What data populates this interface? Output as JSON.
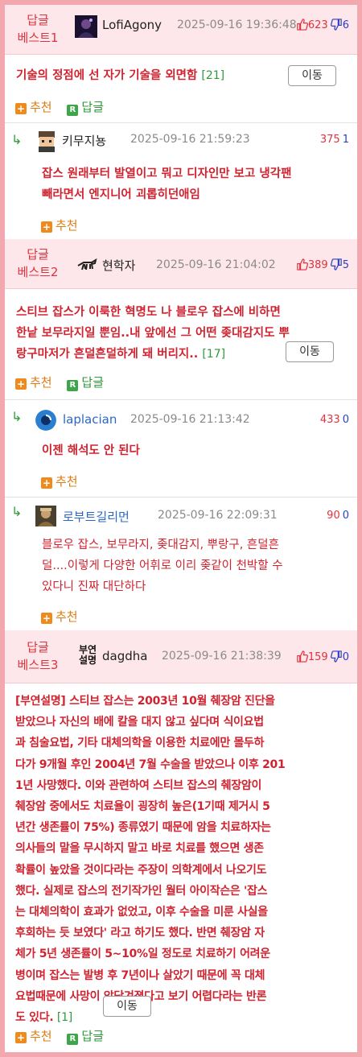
{
  "best1": {
    "rank": [
      "답글",
      "베스트1"
    ],
    "user": "LofiAgony",
    "date": "2025-09-16 19:36:48",
    "up": "623",
    "down": "6",
    "title": "기술의 정점에 선 자가 기술을 외면함",
    "comment_count": "[21]",
    "move_label": "이동",
    "recommend_label": "추천",
    "reply_label": "답글"
  },
  "reply1": {
    "user": "키무지뇽",
    "date": "2025-09-16 21:59:23",
    "up": "375",
    "down": "1",
    "lines": [
      "잡스 원래부터 발열이고 뭐고 디자인만 보고 냉각팬",
      "빼라면서 엔지니어 괴롭히던애임"
    ],
    "recommend_label": "추천"
  },
  "best2": {
    "rank": [
      "답글",
      "베스트2"
    ],
    "user": "현학자",
    "date": "2025-09-16 21:04:02",
    "up": "389",
    "down": "5",
    "lines": [
      "스티브 잡스가 이룩한 혁명도 나 블로우 잡스에 비하면",
      "한낱 보무라지일 뿐임..내 앞에선 그 어떤 좆대감지도 뿌",
      "랑구마저가 흔덜흔덜하게 돼 버리지.."
    ],
    "comment_count": "[17]",
    "move_label": "이동",
    "recommend_label": "추천",
    "reply_label": "답글"
  },
  "reply2": {
    "user": "laplacian",
    "date": "2025-09-16 21:13:42",
    "up": "433",
    "down": "0",
    "lines": [
      "이젠 해석도 안 된다"
    ],
    "recommend_label": "추천"
  },
  "reply3": {
    "user": "로부트길리먼",
    "date": "2025-09-16 22:09:31",
    "up": "90",
    "down": "0",
    "lines": [
      "블로우 잡스, 보무라지, 좆대감지, 뿌랑구, 흔덜흔",
      "덜....이렇게 다양한 어휘로 이리 좆같이 천박할 수",
      "있다니 진짜 대단하다"
    ],
    "recommend_label": "추천"
  },
  "best3": {
    "rank": [
      "답글",
      "베스트3"
    ],
    "avatar_text": [
      "부연",
      "설명"
    ],
    "user": "dagdha",
    "date": "2025-09-16 21:38:39",
    "up": "159",
    "down": "0",
    "lines": [
      "[부연설명] 스티브 잡스는 2003년 10월 췌장암 진단을",
      "받았으나 자신의 배에 칼을 대지 않고 싶다며 식이요법",
      "과 침술요법, 기타 대체의학을 이용한 치료에만 몰두하",
      "다가 9개월 후인 2004년 7월 수술을 받았으나 이후 201",
      "1년 사망했다. 이와 관련하여 스티브 잡스의 췌장암이",
      "췌장암 중에서도 치료율이 굉장히 높은(1기때 제거시 5",
      "년간 생존률이 75%) 종류였기 때문에 암을 치료하자는",
      "의사들의 말을 무시하지 말고 바로 치료를 했으면 생존",
      "확률이 높았을 것이다라는 주장이 의학계에서 나오기도",
      "했다. 실제로 잡스의 전기작가인 월터 아이작슨은 '잡스",
      "는 대체의학이 효과가 없었고, 이후 수술을 미룬 사실을",
      "후회하는 듯 보였다' 라고 하기도 했다. 반면 췌장암 자",
      "체가 5년 생존률이 5~10%일 정도로 치료하기 어려운",
      "병이며 잡스는 발병 후 7년이나 살았기 때문에 꼭 대체",
      "요법때문에 사망이 앞당겨졌다고 보기 어렵다라는 반론",
      "도 있다."
    ],
    "comment_count": "[1]",
    "move_label": "이동",
    "recommend_label": "추천",
    "reply_label": "답글"
  }
}
